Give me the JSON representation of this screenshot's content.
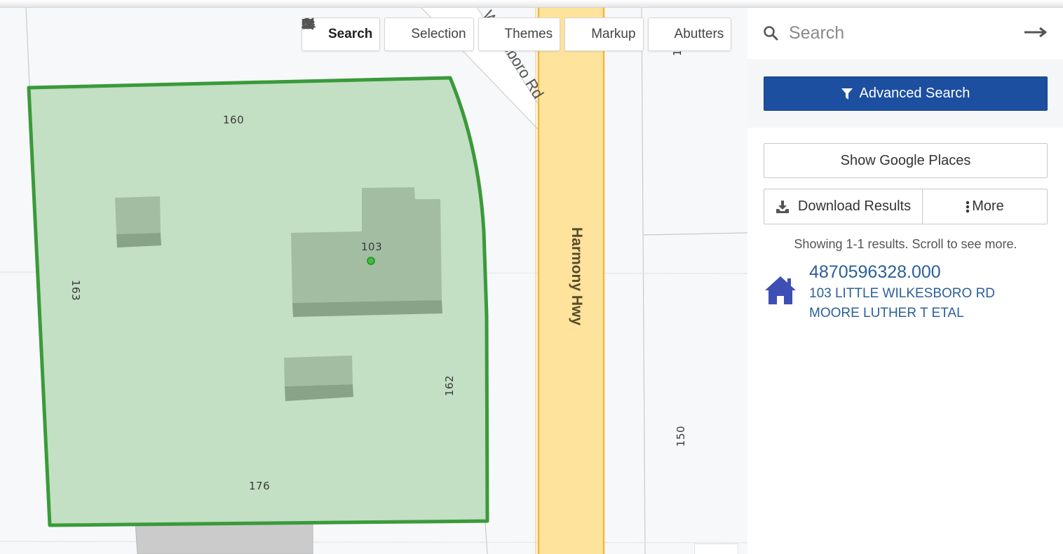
{
  "map": {
    "toolbar": [
      {
        "label": "Search",
        "icon": "search-icon",
        "active": true
      },
      {
        "label": "Selection",
        "icon": "grid-icon",
        "active": false
      },
      {
        "label": "Themes",
        "icon": "layers-icon",
        "active": false
      },
      {
        "label": "Markup",
        "icon": "paintbrush-icon",
        "active": false
      },
      {
        "label": "Abutters",
        "icon": "users-icon",
        "active": false
      }
    ],
    "parcel_labels": {
      "top": "160",
      "left": "163",
      "center": "103",
      "right": "162",
      "bottom": "176",
      "east": "150",
      "top_right_fragment": "1"
    },
    "roads": {
      "main": "Harmony Hwy",
      "diagonal": "Wilkesboro Rd"
    },
    "colors": {
      "parcel_fill": "#c3dfc4",
      "parcel_outline": "#3a9a3a",
      "building": "#a2bda2",
      "highway": "#fde39b",
      "highway_edge": "#f0b840"
    }
  },
  "sidebar": {
    "search_placeholder": "Search",
    "advanced_search_label": "Advanced Search",
    "show_google_places_label": "Show Google Places",
    "download_results_label": "Download Results",
    "more_label": "More",
    "results_summary": "Showing 1-1 results. Scroll to see more.",
    "results": [
      {
        "parcel_id": "4870596328.000",
        "address": "103 LITTLE WILKESBORO RD",
        "owner": "MOORE LUTHER T ETAL",
        "icon": "house-icon"
      }
    ],
    "colors": {
      "primary_button": "#1c4fa0",
      "link": "#2b5f9c",
      "house_icon": "#3d4fb5"
    }
  }
}
